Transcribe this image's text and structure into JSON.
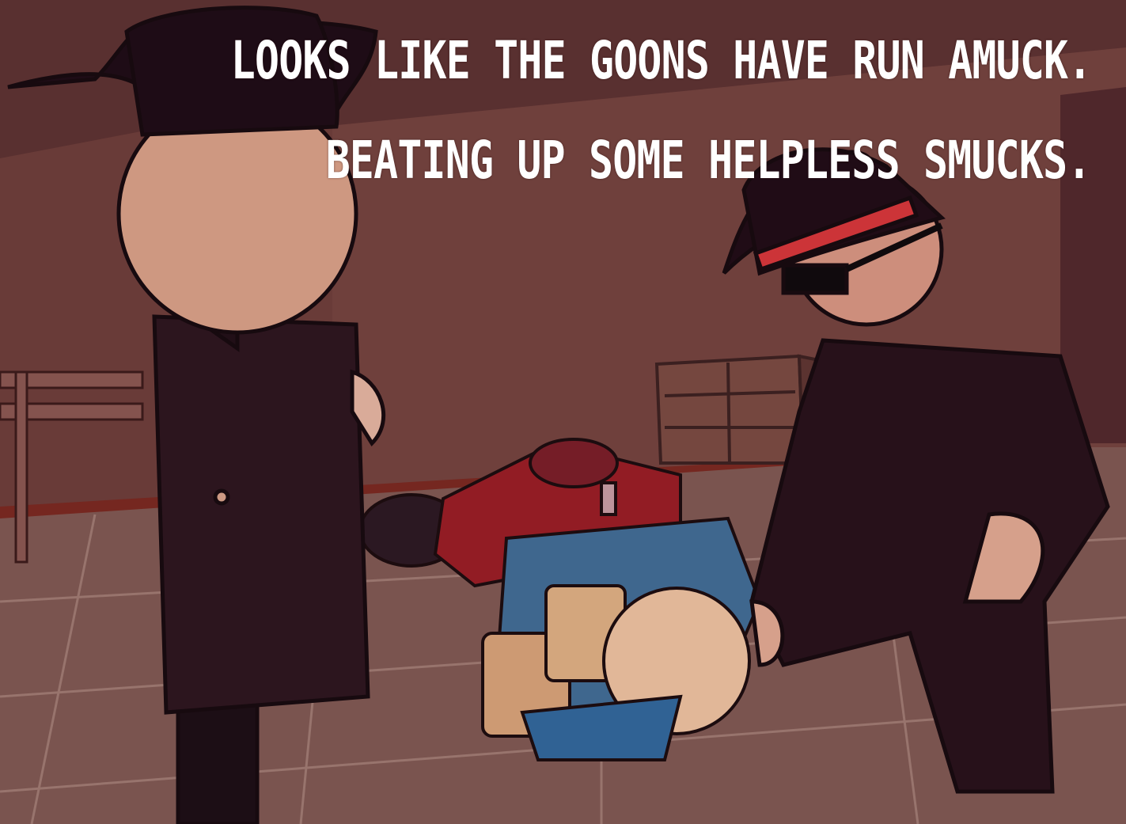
{
  "scene": {
    "description_free": true
  },
  "caption": {
    "line1": "LOOKS LIKE THE GOONS HAVE RUN AMUCK.",
    "line2": "BEATING UP SOME HELPLESS SMUCKS."
  },
  "palette": {
    "wall": "#7a4a45",
    "floor": "#7d5953",
    "coat": "#2a1520",
    "hat": "#1e0d18",
    "skin": "#e4b39a",
    "hat_band": "#d8383c",
    "victim_shirt": "#3f6f9a",
    "victim_red": "#9a1f28",
    "caption_text": "#ffffff"
  }
}
